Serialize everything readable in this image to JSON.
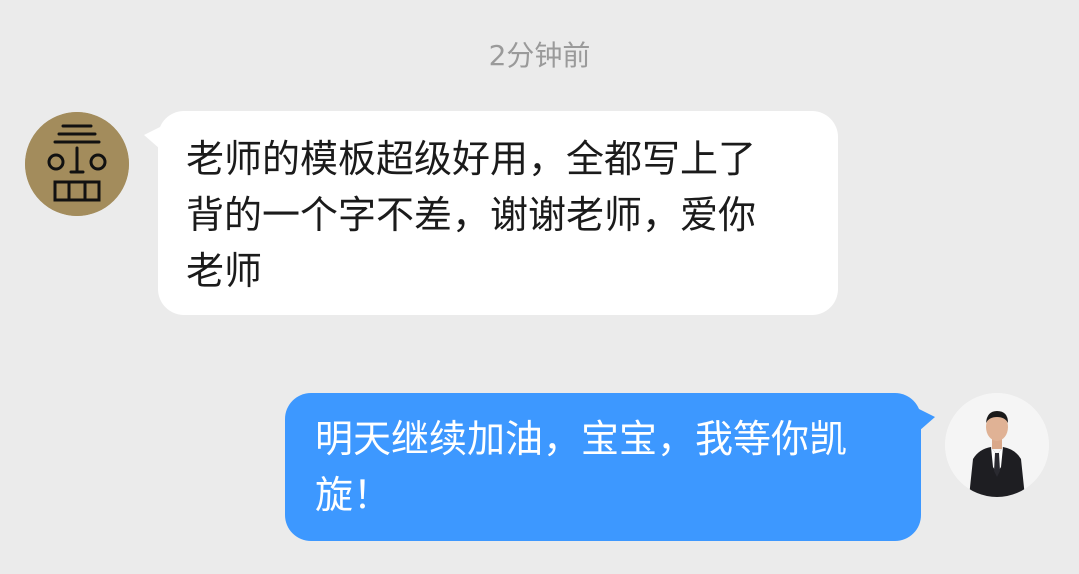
{
  "chat": {
    "timestamp": "2分钟前",
    "messages": [
      {
        "sender": "incoming",
        "avatar_icon": "face-glyph-avatar-icon",
        "lines": [
          "老师的模板超级好用，全都写上了",
          "背的一个字不差，谢谢老师，爱你",
          "老师"
        ]
      },
      {
        "sender": "outgoing",
        "avatar_icon": "man-in-suit-avatar-icon",
        "lines": [
          "明天继续加油，宝宝，我等你凯",
          "旋！"
        ]
      }
    ]
  },
  "colors": {
    "background": "#ebebeb",
    "incoming_bubble": "#ffffff",
    "outgoing_bubble": "#3d98ff",
    "timestamp_text": "#9a9a9a"
  }
}
